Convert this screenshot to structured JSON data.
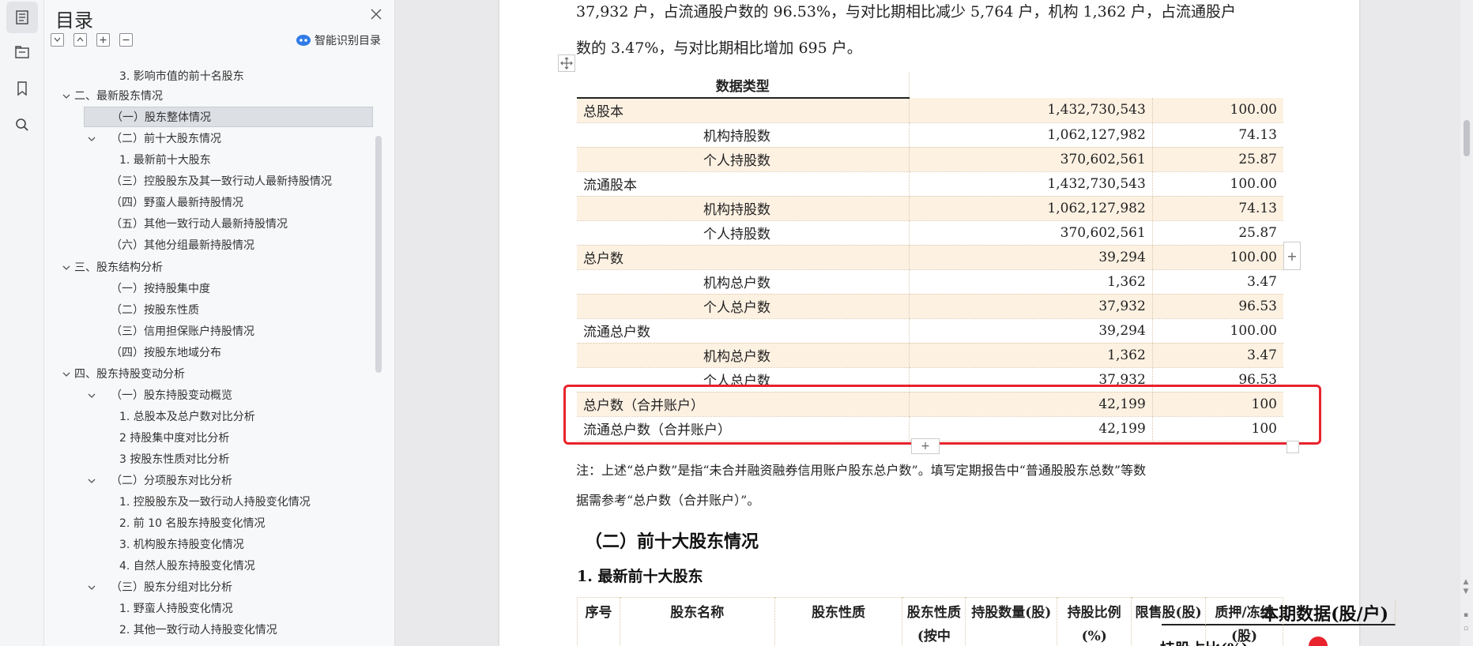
{
  "sidebar": {
    "title": "目录",
    "smart_toc_label": "智能识别目录",
    "items": [
      {
        "label": "3. 影响市值的前十名股东",
        "caret": false
      },
      {
        "label": "二、最新股东情况",
        "caret": true
      },
      {
        "label": "（一）股东整体情况",
        "caret": false
      },
      {
        "label": "（二）前十大股东情况",
        "caret": true
      },
      {
        "label": "1. 最新前十大股东",
        "caret": false
      },
      {
        "label": "（三）控股股东及其一致行动人最新持股情况",
        "caret": false
      },
      {
        "label": "（四）野蛮人最新持股情况",
        "caret": false
      },
      {
        "label": "（五）其他一致行动人最新持股情况",
        "caret": false
      },
      {
        "label": "（六）其他分组最新持股情况",
        "caret": false
      },
      {
        "label": "三、股东结构分析",
        "caret": true
      },
      {
        "label": "（一）按持股集中度",
        "caret": false
      },
      {
        "label": "（二）按股东性质",
        "caret": false
      },
      {
        "label": "（三）信用担保账户持股情况",
        "caret": false
      },
      {
        "label": "（四）按股东地域分布",
        "caret": false
      },
      {
        "label": "四、股东持股变动分析",
        "caret": true
      },
      {
        "label": "（一）股东持股变动概览",
        "caret": true
      },
      {
        "label": "1. 总股本及总户数对比分析",
        "caret": false
      },
      {
        "label": "2 持股集中度对比分析",
        "caret": false
      },
      {
        "label": "3 按股东性质对比分析",
        "caret": false
      },
      {
        "label": "（二）分项股东对比分析",
        "caret": true
      },
      {
        "label": "1. 控股股东及一致行动人持股变化情况",
        "caret": false
      },
      {
        "label": "2. 前 10 名股东持股变化情况",
        "caret": false
      },
      {
        "label": "3. 机构股东持股变化情况",
        "caret": false
      },
      {
        "label": "4. 自然人股东持股变化情况",
        "caret": false
      },
      {
        "label": "（三）股东分组对比分析",
        "caret": true
      },
      {
        "label": "1. 野蛮人持股变化情况",
        "caret": false
      },
      {
        "label": "2. 其他一致行动人持股变化情况",
        "caret": false
      }
    ]
  },
  "document": {
    "para_line1": "37,932 户，占流通股户数的 96.53%，与对比期相比减少 5,764 户，机构 1,362 户，占流通股户",
    "para_line2": "数的 3.47%，与对比期相比增加 695 户。",
    "table": {
      "headers": [
        "数据类型",
        "本期数据(股/户)",
        "持股占比(%)"
      ],
      "rows": [
        [
          "总股本",
          "1,432,730,543",
          "100.00"
        ],
        [
          "机构持股数",
          "1,062,127,982",
          "74.13"
        ],
        [
          "个人持股数",
          "370,602,561",
          "25.87"
        ],
        [
          "流通股本",
          "1,432,730,543",
          "100.00"
        ],
        [
          "机构持股数",
          "1,062,127,982",
          "74.13"
        ],
        [
          "个人持股数",
          "370,602,561",
          "25.87"
        ],
        [
          "总户数",
          "39,294",
          "100.00"
        ],
        [
          "机构总户数",
          "1,362",
          "3.47"
        ],
        [
          "个人总户数",
          "37,932",
          "96.53"
        ],
        [
          "流通总户数",
          "39,294",
          "100.00"
        ],
        [
          "机构总户数",
          "1,362",
          "3.47"
        ],
        [
          "个人总户数",
          "37,932",
          "96.53"
        ],
        [
          "总户数（合并账户）",
          "42,199",
          "100"
        ],
        [
          "流通总户数（合并账户）",
          "42,199",
          "100"
        ]
      ]
    },
    "note_line1": "注：上述“总户数”是指“未合并融资融券信用账户股东总户数”。填写定期报告中“普通股股东总数”等数",
    "note_line2": "据需参考“总户数（合并账户）”。",
    "section_heading": "（二）前十大股东情况",
    "subsection_heading": "1. 最新前十大股东",
    "top10_headers": [
      "序号",
      "股东名称",
      "股东性质",
      "股东性质(按中",
      "持股数量(股)",
      "持股比例(%)",
      "限售股(股)",
      "质押/冻结(股)"
    ]
  },
  "colors": {
    "highlight_border": "#e8232d",
    "row_shade": "#fdf1e2"
  }
}
